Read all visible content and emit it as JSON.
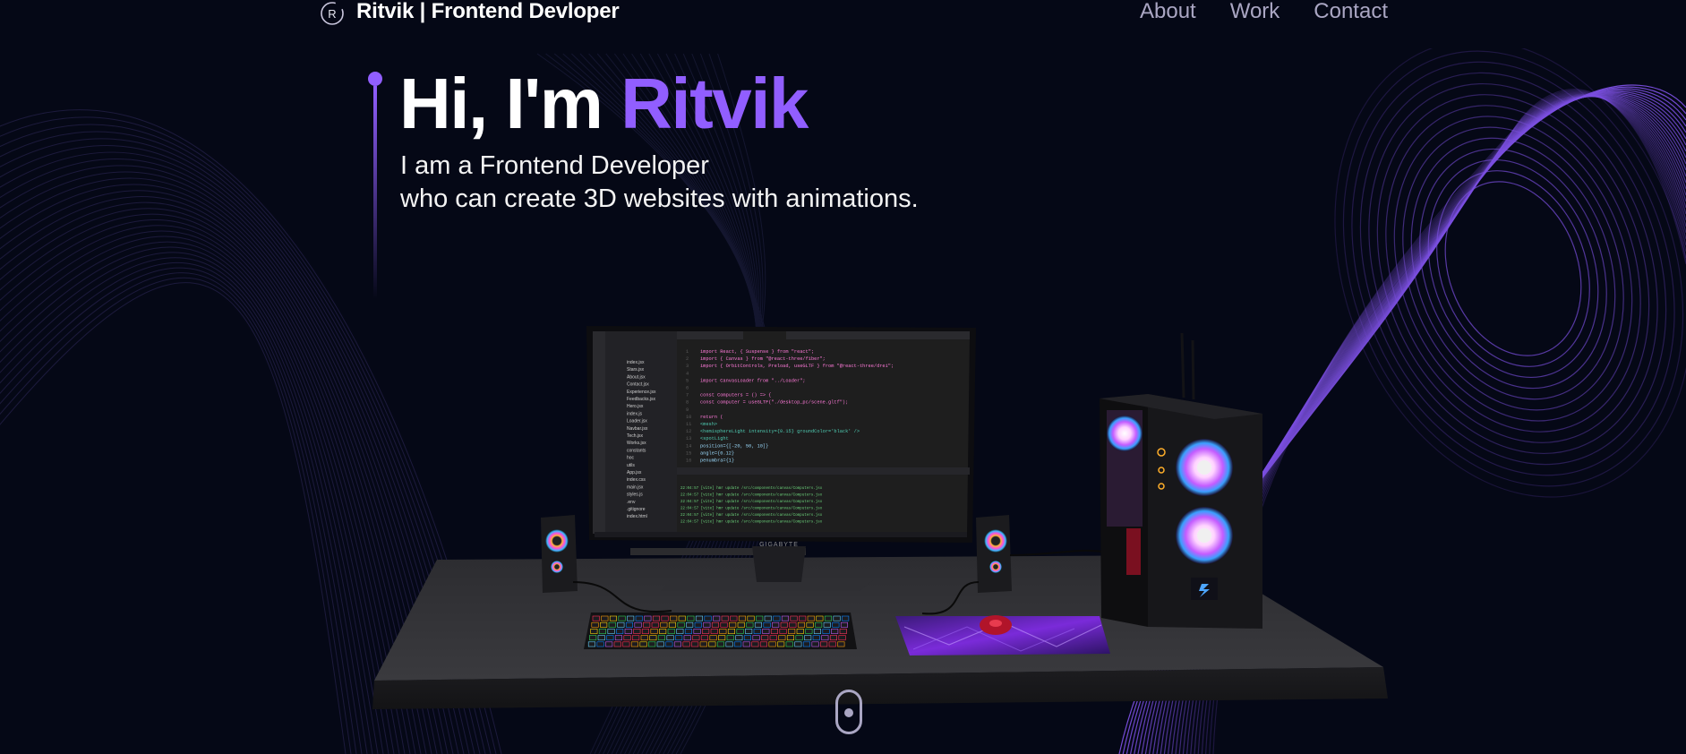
{
  "nav": {
    "logo_letter": "R",
    "brand": "Ritvik | Frontend Devloper",
    "links": [
      {
        "label": "About"
      },
      {
        "label": "Work"
      },
      {
        "label": "Contact"
      }
    ]
  },
  "hero": {
    "greeting": "Hi, I'm ",
    "name": "Ritvik",
    "subtitle_line1": "I am a Frontend Developer",
    "subtitle_line2": "who can create 3D websites with animations."
  },
  "scene": {
    "monitor_brand": "GIGABYTE",
    "code_lines": [
      "import React, { Suspense } from \"react\";",
      "import { Canvas } from \"@react-three/fiber\";",
      "import { OrbitControls, Preload, useGLTF } from \"@react-three/drei\";",
      "",
      "import CanvasLoader from \"../Loader\";",
      "",
      "const Computers = () => {",
      "  const computer = useGLTF(\"./desktop_pc/scene.gltf\");",
      "",
      "  return (",
      "    <mesh>",
      "      <hemisphereLight intensity={0.15} groundColor='black' />",
      "      <spotLight",
      "        position={[-20, 50, 10]}",
      "        angle={0.12}",
      "        penumbra={1}"
    ],
    "file_tree": [
      "index.jsx",
      "Stars.jsx",
      "About.jsx",
      "Contact.jsx",
      "Experience.jsx",
      "Feedbacks.jsx",
      "Hero.jsx",
      "index.js",
      "Loader.jsx",
      "Navbar.jsx",
      "Tech.jsx",
      "Works.jsx",
      "constants",
      "hoc",
      "utils",
      "App.jsx",
      "index.css",
      "main.jsx",
      "styles.js",
      ".env",
      ".gitignore",
      "index.html"
    ]
  },
  "colors": {
    "background": "#050816",
    "accent": "#915eff",
    "nav_text": "#aaa6c3"
  }
}
